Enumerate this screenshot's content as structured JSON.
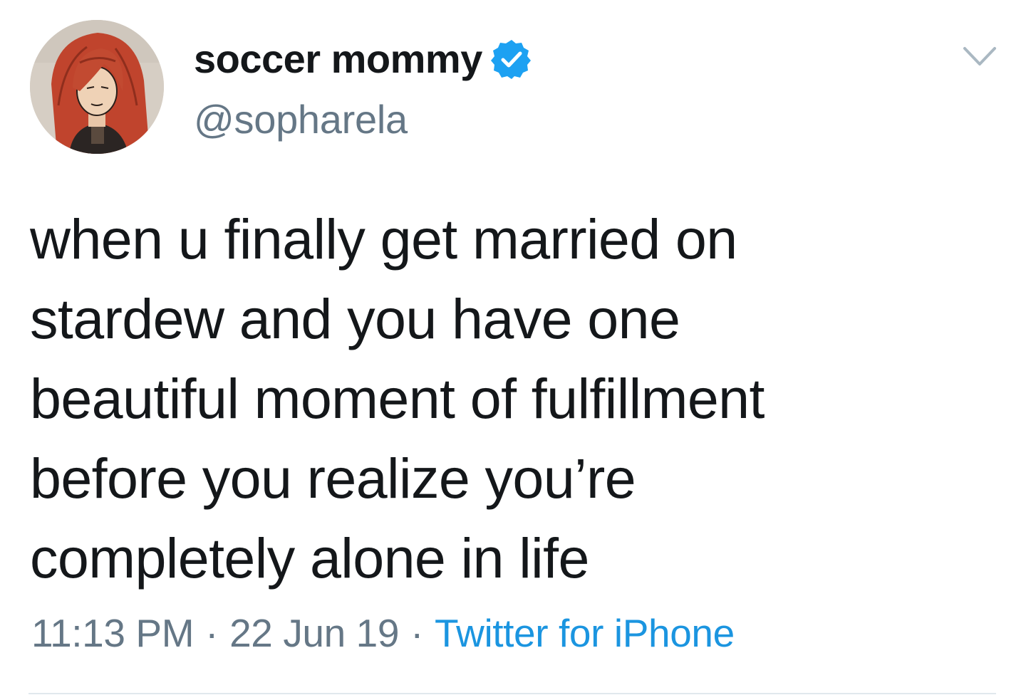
{
  "tweet": {
    "author": {
      "display_name": "soccer mommy",
      "handle": "@sopharela",
      "verified": true,
      "avatar_icon": "cartoon-avatar-red-hair"
    },
    "text_lines": [
      "when u finally get married on",
      "stardew and you have one",
      "beautiful moment of fulfillment",
      "before you realize you’re",
      "completely alone in life"
    ],
    "time": "11:13 PM",
    "date": "22 Jun 19",
    "source": "Twitter for iPhone",
    "separator": "·",
    "icons": {
      "verified": "verified-badge-icon",
      "menu": "chevron-down-icon"
    },
    "colors": {
      "text": "#14171a",
      "secondary": "#657786",
      "accent": "#1b95e0",
      "verified": "#1da1f2",
      "divider": "#e1e8ed"
    }
  }
}
